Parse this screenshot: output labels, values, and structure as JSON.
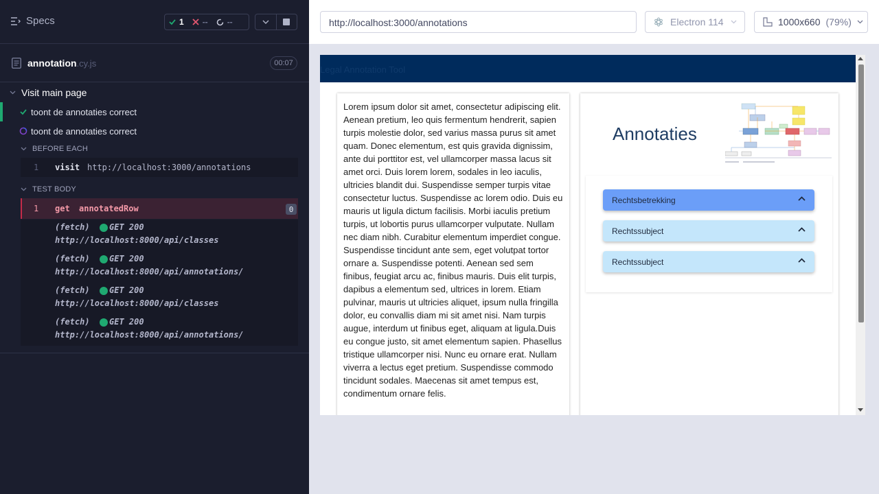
{
  "reporter": {
    "specs_label": "Specs",
    "stats": {
      "passed": "1",
      "failed": "--",
      "pending": "--"
    },
    "spec": {
      "name": "annotation",
      "ext": ".cy.js",
      "duration": "00:07"
    },
    "suite": {
      "title": "Visit main page",
      "tests": [
        {
          "label": "toont de annotaties correct",
          "state": "passed"
        },
        {
          "label": "toont de annotaties correct",
          "state": "running"
        }
      ],
      "before_each": {
        "title": "BEFORE EACH",
        "command": {
          "num": "1",
          "name": "visit",
          "message": "http://localhost:3000/annotations"
        }
      },
      "test_body": {
        "title": "TEST BODY",
        "command": {
          "num": "1",
          "name": "get",
          "message": "annotatedRow",
          "count": "0"
        },
        "fetches": [
          {
            "type": "(fetch)",
            "status": "GET 200",
            "url": "http://localhost:8000/api/classes"
          },
          {
            "type": "(fetch)",
            "status": "GET 200",
            "url": "http://localhost:8000/api/annotations/"
          },
          {
            "type": "(fetch)",
            "status": "GET 200",
            "url": "http://localhost:8000/api/classes"
          },
          {
            "type": "(fetch)",
            "status": "GET 200",
            "url": "http://localhost:8000/api/annotations/"
          }
        ]
      }
    }
  },
  "aut_header": {
    "url": "http://localhost:3000/annotations",
    "browser": "Electron 114",
    "viewport": "1000x660",
    "zoom": "(79%)"
  },
  "app": {
    "title": "Legal Annotation Tool",
    "body_text": "Lorem ipsum dolor sit amet, consectetur adipiscing elit. Aenean pretium, leo quis fermentum hendrerit, sapien turpis molestie dolor, sed varius massa purus sit amet quam. Donec elementum, est quis gravida dignissim, ante dui porttitor est, vel ullamcorper massa lacus sit amet orci. Duis lorem lorem, sodales in leo iaculis, ultricies blandit dui. Suspendisse semper turpis vitae consectetur luctus. Suspendisse ac lorem odio. Duis eu mauris ut ligula dictum facilisis. Morbi iaculis pretium turpis, ut lobortis purus ullamcorper vulputate. Nullam nec diam nibh. Curabitur elementum imperdiet congue. Suspendisse tincidunt ante sem, eget volutpat tortor ornare a. Suspendisse potenti. Aenean sed sem finibus, feugiat arcu ac, finibus mauris. Duis elit turpis, dapibus a elementum sed, ultrices in lorem. Etiam pulvinar, mauris ut ultricies aliquet, ipsum nulla fringilla dolor, eu convallis diam mi sit amet nisi. Nam turpis augue, interdum ut finibus eget, aliquam at ligula.Duis eu congue justo, sit amet elementum sapien. Phasellus tristique ullamcorper nisi. Nunc eu ornare erat. Nullam viverra a lectus eget pretium. Suspendisse commodo tincidunt sodales. Maecenas sit amet tempus est, condimentum ornare felis.",
    "annotations_title": "Annotaties",
    "annotations": [
      {
        "label": "Rechtsbetrekking",
        "color": "#6b9ef8"
      },
      {
        "label": "Rechtssubject",
        "color": "#c4e6fb"
      },
      {
        "label": "Rechtssubject",
        "color": "#c4e6fb"
      }
    ]
  },
  "colors": {
    "reporter_bg": "#1b1e2e",
    "pass_green": "#1fa971",
    "fail_red": "#c62b49",
    "app_bar": "#002b5c"
  }
}
